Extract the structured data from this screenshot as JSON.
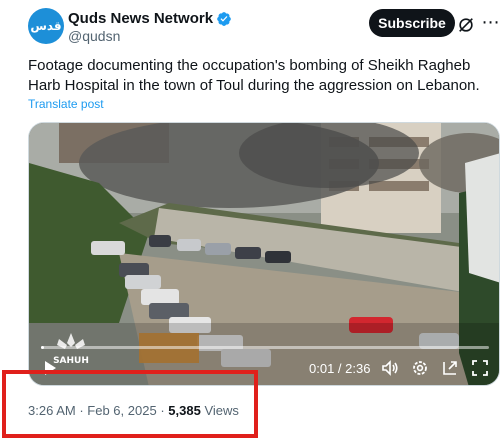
{
  "account": {
    "display_name": "Quds News Network",
    "handle": "@qudsn",
    "avatar_text": "قدس",
    "subscribe_label": "Subscribe"
  },
  "post": {
    "text": "Footage documenting the occupation's bombing of Sheikh Ragheb Harb Hospital in the town of Toul during the aggression on Lebanon.",
    "translate_label": "Translate post"
  },
  "video": {
    "time_display": "0:01 / 2:36",
    "progress": 0.006,
    "watermark_text": "SAHUH"
  },
  "meta": {
    "time": "3:26 AM",
    "separator": "·",
    "date": "Feb 6, 2025",
    "views_count": "5,385",
    "views_label": "Views"
  },
  "colors": {
    "accent": "#1d9bf0",
    "highlight": "#e0201b",
    "avatar_bg": "#1d8fd8"
  },
  "icons": {
    "verified": "verified-badge-icon",
    "grok": "grok-icon",
    "more": "more-options-icon",
    "play": "play-icon",
    "volume": "volume-icon",
    "settings": "settings-icon",
    "pip": "picture-in-picture-icon",
    "fullscreen": "fullscreen-icon"
  }
}
